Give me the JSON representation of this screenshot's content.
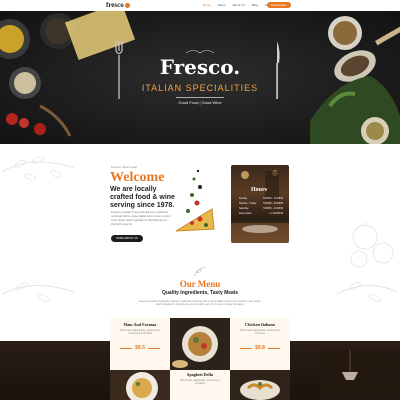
{
  "nav": {
    "logo": "fresco",
    "links": [
      "Home",
      "Menu",
      "About Us",
      "Blog",
      "Contact"
    ],
    "active_index": 0,
    "cta": "Reservation"
  },
  "hero": {
    "title": "Fresco.",
    "subtitle": "ITALIAN SPECIALITIES",
    "tagline": "Good Food | Good Wine"
  },
  "welcome": {
    "kicker": "Fresco's Best Look!",
    "title": "Welcome",
    "subtitle": "We are locally crafted food & wine serving since 1978.",
    "body": "Fresco's provides Tuscan-like flavours, traditional combined with a unique Italian twist in every portion, every recipe. Each ingredient is cherished by our chef with every lot.",
    "button": "MORE ABOUT US"
  },
  "hours": {
    "title": "Hours",
    "rows": [
      {
        "day": "Sunday",
        "time": "5:00PM - 11:00PM"
      },
      {
        "day": "Monday - Friday",
        "time": "5:00PM - 11:00PM"
      },
      {
        "day": "Saturday",
        "time": "5:00PM - 11:00PM"
      },
      {
        "day": "Reservation",
        "time": "+1 12345678"
      }
    ]
  },
  "menu": {
    "title": "Our Menu",
    "subtitle": "Quality Ingredients, Tasty Meals",
    "body": "Fresco's provides Tuscan-like flavours, traditional combined with a unique Italian twist in every portion, every recipe. Each ingredient is cherished by our chef with every lot, it does no matter how tasty.",
    "cards": [
      {
        "title": "Ham And Formaa",
        "desc": "Homemade pappardelle, ground beef, tomatoes & fresh basil",
        "price": "$9.5"
      },
      {
        "title": "Chicken Italiano",
        "desc": "Homemade pappardelle, ground beef, tomatoes",
        "price": "$9.8"
      },
      {
        "title": "Spagheti Della",
        "desc": "Homemade pappardelle, ground beef, tomatoes"
      }
    ]
  },
  "colors": {
    "accent": "#e87722",
    "dark": "#1c1c1c",
    "cream": "#fff8ee"
  },
  "icons": [
    "fork-icon",
    "knife-icon",
    "leaf-ornament-icon",
    "divider-ornament-icon"
  ]
}
